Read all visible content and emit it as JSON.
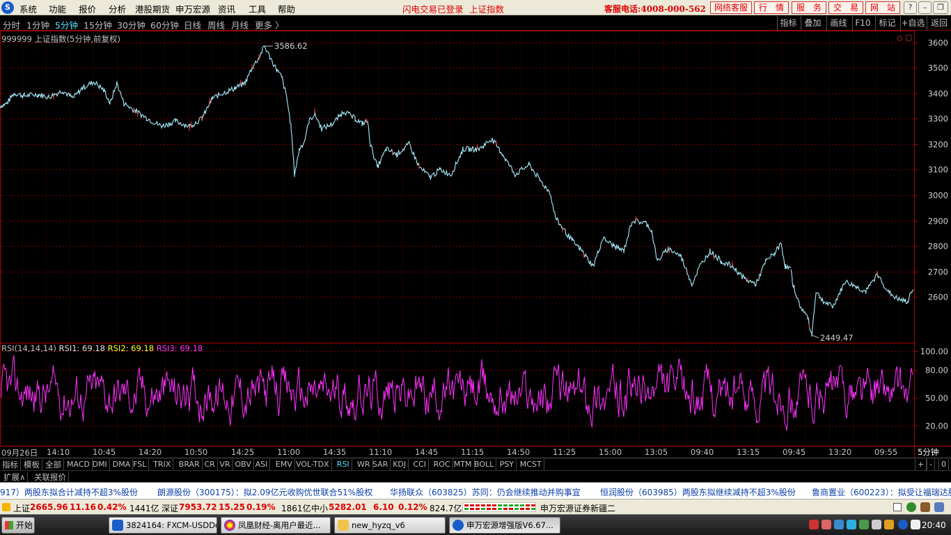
{
  "menubar": {
    "logo": "S",
    "items": [
      "系统",
      "功能",
      "报价",
      "分析",
      "港股期货",
      "申万宏源",
      "资讯",
      "工具",
      "帮助"
    ],
    "status_text": "闪电交易已登录",
    "index_name": "上证指数",
    "hotline": "客服电话:4008-000-562",
    "buttons": [
      "网络客服",
      "行　情",
      "服　务",
      "交　易",
      "网　站"
    ],
    "window_controls": [
      "?",
      "–",
      "❐",
      "✕"
    ]
  },
  "toolbar": {
    "periods": [
      "分时",
      "1分钟",
      "5分钟",
      "15分钟",
      "30分钟",
      "60分钟",
      "日线",
      "周线",
      "月线",
      "更多 〉"
    ],
    "active_period": "5分钟",
    "right_tools": [
      "指标",
      "叠加",
      "画线",
      "F10",
      "标记",
      "+自选",
      "返回"
    ]
  },
  "chart": {
    "title": "999999 上证指数(5分钟,前复权)",
    "max_label": "3586.62",
    "min_label": "2449.47",
    "corner_icons": [
      "◇",
      "▢"
    ],
    "rsi_legend": {
      "name": "RSI(14,14,14)",
      "rsi1": "RSI1: 69.18",
      "rsi2": "RSI2: 69.18",
      "rsi3": "RSI3: 69.18"
    },
    "period_label": "5分钟",
    "colors": {
      "price": "#a8f0ff",
      "up": "#ff3030",
      "rsi": "#ff33ff",
      "grid": "#7a0000",
      "axis": "#b00000"
    }
  },
  "chart_data": {
    "type": "line",
    "y_ticks": [
      "3600",
      "3500",
      "3400",
      "3300",
      "3200",
      "3100",
      "3000",
      "2900",
      "2800",
      "2700",
      "2600"
    ],
    "ylim": [
      2420,
      3640
    ],
    "rsi_ticks": [
      "100.00",
      "80.00",
      "50.00",
      "20.00"
    ],
    "x_labels": [
      "09月26日",
      "14:10",
      "10:45",
      "14:20",
      "10:50",
      "14:25",
      "11:00",
      "14:35",
      "11:10",
      "14:45",
      "11:15",
      "14:50",
      "11:25",
      "15:00",
      "13:05",
      "09:40",
      "13:15",
      "09:45",
      "13:20",
      "09:55"
    ],
    "series": [
      {
        "name": "上证指数",
        "points": [
          [
            0,
            3350
          ],
          [
            10,
            3360
          ],
          [
            20,
            3400
          ],
          [
            35,
            3390
          ],
          [
            55,
            3395
          ],
          [
            70,
            3385
          ],
          [
            90,
            3410
          ],
          [
            105,
            3380
          ],
          [
            118,
            3420
          ],
          [
            135,
            3445
          ],
          [
            150,
            3410
          ],
          [
            158,
            3360
          ],
          [
            168,
            3440
          ],
          [
            178,
            3360
          ],
          [
            195,
            3330
          ],
          [
            212,
            3300
          ],
          [
            232,
            3270
          ],
          [
            252,
            3290
          ],
          [
            272,
            3270
          ],
          [
            290,
            3300
          ],
          [
            305,
            3380
          ],
          [
            320,
            3400
          ],
          [
            338,
            3420
          ],
          [
            352,
            3440
          ],
          [
            362,
            3500
          ],
          [
            372,
            3540
          ],
          [
            380,
            3585
          ],
          [
            388,
            3540
          ],
          [
            398,
            3490
          ],
          [
            405,
            3460
          ],
          [
            412,
            3380
          ],
          [
            418,
            3270
          ],
          [
            423,
            3080
          ],
          [
            430,
            3180
          ],
          [
            437,
            3210
          ],
          [
            444,
            3290
          ],
          [
            452,
            3320
          ],
          [
            462,
            3260
          ],
          [
            478,
            3280
          ],
          [
            494,
            3330
          ],
          [
            510,
            3300
          ],
          [
            520,
            3280
          ],
          [
            528,
            3290
          ],
          [
            532,
            3200
          ],
          [
            542,
            3110
          ],
          [
            555,
            3180
          ],
          [
            570,
            3160
          ],
          [
            588,
            3200
          ],
          [
            602,
            3110
          ],
          [
            618,
            3070
          ],
          [
            632,
            3100
          ],
          [
            648,
            3080
          ],
          [
            665,
            3180
          ],
          [
            688,
            3180
          ],
          [
            706,
            3220
          ],
          [
            722,
            3160
          ],
          [
            740,
            3080
          ],
          [
            760,
            3120
          ],
          [
            775,
            3060
          ],
          [
            790,
            3010
          ],
          [
            798,
            2910
          ],
          [
            808,
            2870
          ],
          [
            822,
            2820
          ],
          [
            836,
            2780
          ],
          [
            852,
            2720
          ],
          [
            866,
            2830
          ],
          [
            882,
            2800
          ],
          [
            896,
            2780
          ],
          [
            908,
            2900
          ],
          [
            928,
            2890
          ],
          [
            936,
            2860
          ],
          [
            944,
            2740
          ],
          [
            960,
            2790
          ],
          [
            978,
            2760
          ],
          [
            994,
            2650
          ],
          [
            1005,
            2720
          ],
          [
            1020,
            2780
          ],
          [
            1036,
            2740
          ],
          [
            1052,
            2720
          ],
          [
            1070,
            2670
          ],
          [
            1086,
            2650
          ],
          [
            1100,
            2740
          ],
          [
            1112,
            2770
          ],
          [
            1122,
            2810
          ],
          [
            1128,
            2720
          ],
          [
            1136,
            2710
          ],
          [
            1138,
            2660
          ],
          [
            1148,
            2570
          ],
          [
            1160,
            2520
          ],
          [
            1166,
            2450
          ],
          [
            1172,
            2620
          ],
          [
            1184,
            2580
          ],
          [
            1196,
            2560
          ],
          [
            1214,
            2660
          ],
          [
            1230,
            2640
          ],
          [
            1244,
            2620
          ],
          [
            1260,
            2690
          ],
          [
            1276,
            2620
          ],
          [
            1290,
            2590
          ],
          [
            1304,
            2580
          ],
          [
            1312,
            2640
          ]
        ]
      },
      {
        "name": "RSI",
        "range": [
          0,
          100
        ],
        "baseline": 50,
        "last": 69.18
      }
    ]
  },
  "indicators": {
    "tabs": [
      "指标",
      "模板",
      "全部",
      "MACD",
      "DMI",
      "DMA",
      "FSL",
      "TRIX",
      "BRAR",
      "CR",
      "VR",
      "OBV",
      "ASI",
      "EMV",
      "VOL-TDX",
      "RSI",
      "WR",
      "SAR",
      "KDJ",
      "CCI",
      "ROC",
      "MTM",
      "BOLL",
      "PSY",
      "MCST"
    ],
    "active": "RSI",
    "controls": [
      "+",
      "-",
      "0"
    ]
  },
  "expand_row": [
    "扩展∧",
    "关联报价"
  ],
  "ticker": [
    "917）两股东拟合计减持不超3%股份",
    "朗源股份（300175）：拟2.09亿元收购优世联合51%股权",
    "华扬联众（603825）苏同：仍会继续推动并购事宜",
    "恒润股份（603985）两股东拟继续减持不超3%股份",
    "鲁商置业（600223）：拟受让福瑞达股"
  ],
  "statusbar": {
    "sh_label": "上证",
    "sh_value": "2665.96",
    "sh_change": "11.16",
    "sh_pct": "0.42%",
    "sh_amount": "1441亿",
    "sz_label": "深证",
    "sz_value": "7953.72",
    "sz_change": "15.25",
    "sz_pct": "0.19%",
    "sz_amount": "1861亿",
    "zx_label": "中小",
    "zx_value": "5282.01",
    "zx_change": "6.10",
    "zx_pct": "0.12%",
    "zx_amount": "824.7亿",
    "server": "申万宏源证券新疆二"
  },
  "taskbar": {
    "start": "开始",
    "tasks": [
      "3824164: FXCM-USDDe...",
      "凤凰财经-离用户最近...",
      "new_hyzq_v6",
      "申万宏源增强版V6.67..."
    ],
    "clock": "20:40"
  }
}
